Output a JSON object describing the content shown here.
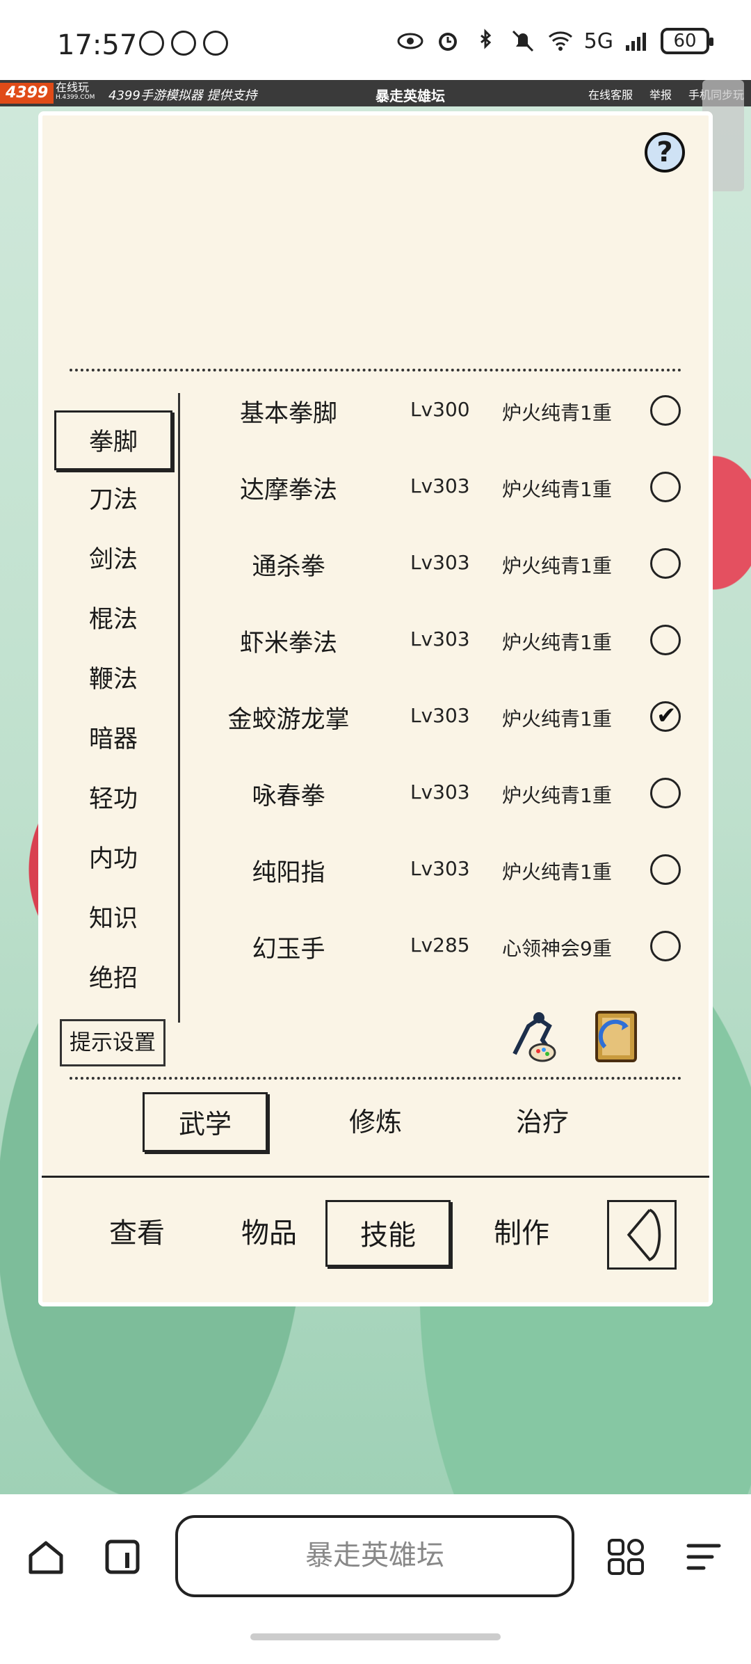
{
  "status_bar": {
    "time": "17:57",
    "network": "5G",
    "battery": "60"
  },
  "game_bar": {
    "logo": "4399",
    "logo_sub1": "在线玩",
    "logo_sub2": "H.4399.COM",
    "brand": "4399手游模拟器 提供支持",
    "title": "暴走英雄坛",
    "links": [
      "在线客服",
      "举报",
      "手机同步玩"
    ]
  },
  "panel": {
    "help_symbol": "?",
    "side_tabs": [
      {
        "label": "拳脚",
        "active": true
      },
      {
        "label": "刀法"
      },
      {
        "label": "剑法"
      },
      {
        "label": "棍法"
      },
      {
        "label": "鞭法"
      },
      {
        "label": "暗器"
      },
      {
        "label": "轻功"
      },
      {
        "label": "内功"
      },
      {
        "label": "知识"
      },
      {
        "label": "绝招"
      }
    ],
    "hint_settings": "提示设置",
    "skills": [
      {
        "name": "基本拳脚",
        "level": "Lv300",
        "stage": "炉火纯青1重",
        "checked": false
      },
      {
        "name": "达摩拳法",
        "level": "Lv303",
        "stage": "炉火纯青1重",
        "checked": false
      },
      {
        "name": "通杀拳",
        "level": "Lv303",
        "stage": "炉火纯青1重",
        "checked": false
      },
      {
        "name": "虾米拳法",
        "level": "Lv303",
        "stage": "炉火纯青1重",
        "checked": false
      },
      {
        "name": "金蛟游龙掌",
        "level": "Lv303",
        "stage": "炉火纯青1重",
        "checked": true
      },
      {
        "name": "咏春拳",
        "level": "Lv303",
        "stage": "炉火纯青1重",
        "checked": false
      },
      {
        "name": "纯阳指",
        "level": "Lv303",
        "stage": "炉火纯青1重",
        "checked": false
      },
      {
        "name": "幻玉手",
        "level": "Lv285",
        "stage": "心领神会9重",
        "checked": false
      }
    ],
    "sub_tabs": [
      {
        "label": "武学",
        "active": true
      },
      {
        "label": "修炼"
      },
      {
        "label": "治疗"
      }
    ],
    "bottom_tabs": [
      {
        "label": "查看"
      },
      {
        "label": "物品"
      },
      {
        "label": "技能",
        "active": true
      },
      {
        "label": "制作"
      }
    ]
  },
  "browser": {
    "address": "暴走英雄坛"
  }
}
